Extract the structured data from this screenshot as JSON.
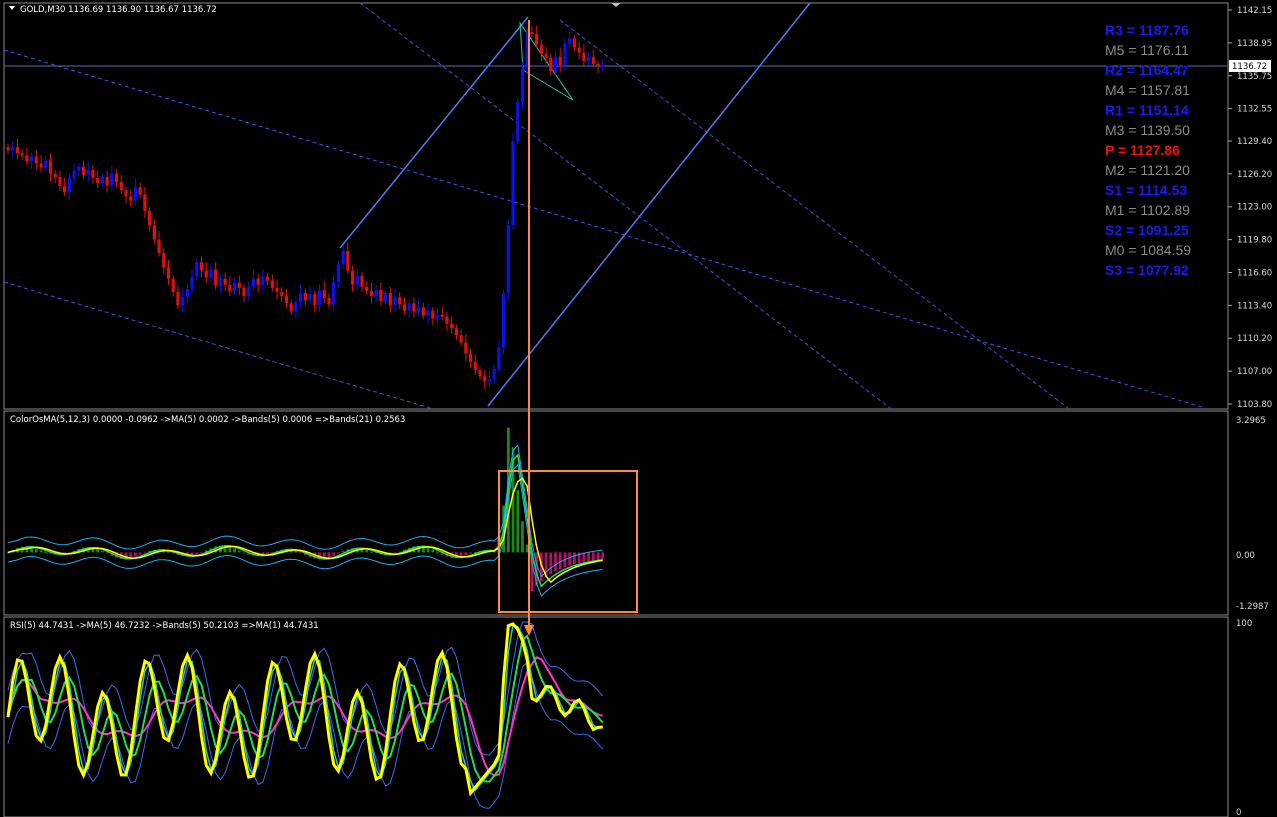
{
  "main_panel": {
    "title": "GOLD,M30  1136.69 1136.90 1136.67 1136.72",
    "current_price": "1136.72",
    "price_ticks": [
      "1142.15",
      "1138.95",
      "1135.75",
      "1132.55",
      "1129.40",
      "1126.20",
      "1123.00",
      "1119.80",
      "1116.60",
      "1113.40",
      "1110.20",
      "1107.00",
      "1103.80"
    ],
    "pivots": [
      {
        "label": "R3 = 1187.76",
        "color": "#1a1aee"
      },
      {
        "label": "M5 = 1176.11",
        "color": "#8a8a8a"
      },
      {
        "label": "R2 = 1164.47",
        "color": "#1a1aee"
      },
      {
        "label": "M4 = 1157.81",
        "color": "#8a8a8a"
      },
      {
        "label": "R1 = 1151.14",
        "color": "#1a1aee"
      },
      {
        "label": "M3 = 1139.50",
        "color": "#8a8a8a"
      },
      {
        "label": "P  = 1127.86",
        "color": "#ee1111"
      },
      {
        "label": "M2 = 1121.20",
        "color": "#8a8a8a"
      },
      {
        "label": "S1 = 1114.53",
        "color": "#1a1aee"
      },
      {
        "label": "M1 = 1102.89",
        "color": "#8a8a8a"
      },
      {
        "label": "S2 = 1091.25",
        "color": "#1a1aee"
      },
      {
        "label": "M0 = 1084.59",
        "color": "#8a8a8a"
      },
      {
        "label": "S3 = 1077.92",
        "color": "#1a1aee"
      }
    ]
  },
  "osma_panel": {
    "title": "ColorOsMA(5,12,3) 0.0000 -0.0962  ->MA(5) 0.0002  ->Bands(5) 0.0006  =>Bands(21) 0.2563",
    "ticks": [
      "3.2965",
      "0.00",
      "-1.2987"
    ]
  },
  "rsi_panel": {
    "title": "RSI(5) 44.7431  ->MA(5) 46.7232  ->Bands(5) 50.2103  =>MA(1) 44.7431",
    "ticks": [
      "100",
      "0"
    ]
  },
  "colors": {
    "bull": "#1010ee",
    "bear": "#e01010",
    "trend": "#4f6cf0",
    "annotation": "#ff8a3d",
    "rsi": "#ffff00",
    "ma_pink": "#ff33cc",
    "ma_green": "#22dd55",
    "band_blue": "#3a6cf0",
    "osma_pos": "#1a8a1a",
    "osma_neg": "#b0106a"
  },
  "chart_data": {
    "type": "candlestick",
    "symbol": "GOLD",
    "timeframe": "M30",
    "last_quote": {
      "open": 1136.69,
      "high": 1136.9,
      "low": 1136.67,
      "close": 1136.72
    },
    "ylim": [
      1103.8,
      1142.15
    ],
    "closes": [
      1128.5,
      1128.8,
      1128.2,
      1128.0,
      1127.4,
      1127.9,
      1127.2,
      1126.8,
      1127.5,
      1126.2,
      1125.9,
      1125.0,
      1124.4,
      1125.8,
      1126.5,
      1126.9,
      1126.1,
      1126.6,
      1125.8,
      1125.3,
      1125.9,
      1125.1,
      1126.2,
      1125.4,
      1124.6,
      1124.0,
      1123.6,
      1124.9,
      1124.2,
      1122.6,
      1121.2,
      1119.8,
      1118.5,
      1117.1,
      1116.0,
      1114.7,
      1113.4,
      1114.2,
      1115.0,
      1116.2,
      1117.6,
      1116.8,
      1116.1,
      1116.9,
      1115.3,
      1116.0,
      1115.4,
      1114.8,
      1115.6,
      1115.1,
      1114.3,
      1115.2,
      1116.0,
      1115.4,
      1116.2,
      1115.8,
      1115.1,
      1114.7,
      1114.3,
      1113.6,
      1112.8,
      1113.7,
      1114.6,
      1113.9,
      1114.5,
      1113.4,
      1114.9,
      1114.1,
      1113.5,
      1115.7,
      1117.4,
      1118.7,
      1116.8,
      1115.4,
      1116.3,
      1115.2,
      1114.8,
      1114.3,
      1114.9,
      1113.8,
      1114.6,
      1113.4,
      1114.2,
      1113.5,
      1112.9,
      1113.6,
      1112.8,
      1113.2,
      1112.4,
      1112.9,
      1112.1,
      1112.5,
      1112.3,
      1111.6,
      1111.2,
      1110.5,
      1109.8,
      1108.7,
      1107.9,
      1107.1,
      1106.5,
      1106.0,
      1106.2,
      1107.2,
      1109.3,
      1114.6,
      1121.2,
      1129.4,
      1133.2,
      1136.4,
      1140.0,
      1139.8,
      1138.8,
      1137.9,
      1137.5,
      1136.2,
      1137.6,
      1136.8,
      1138.9,
      1139.4,
      1138.5,
      1138.0,
      1137.2,
      1137.6,
      1136.9,
      1136.7,
      1136.72
    ],
    "osma_range": [
      -1.2987,
      3.2965
    ],
    "rsi_range": [
      0,
      100
    ],
    "rsi_last": 44.7431,
    "rsi_ma5": 46.7232,
    "rsi_bands5": 50.2103
  }
}
